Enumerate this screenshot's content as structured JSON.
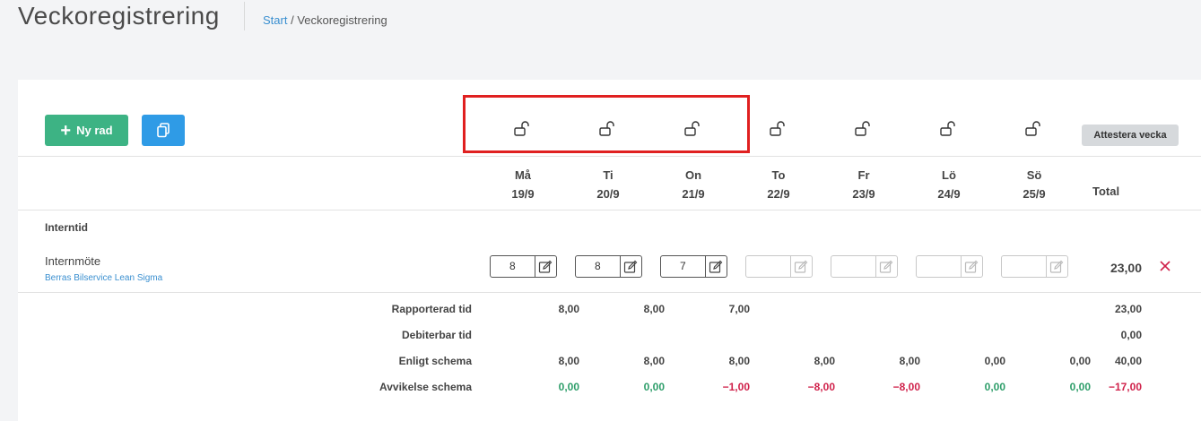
{
  "header": {
    "title": "Veckoregistrering"
  },
  "breadcrumb": {
    "start": "Start",
    "separator": " / ",
    "current": "Veckoregistrering"
  },
  "toolbar": {
    "new_row_label": "Ny rad",
    "new_row_icon": "plus-icon",
    "copy_icon": "copy-icon",
    "attest_label": "Attestera vecka"
  },
  "days": [
    {
      "name": "Må",
      "date": "19/9",
      "locked": false
    },
    {
      "name": "Ti",
      "date": "20/9",
      "locked": false
    },
    {
      "name": "On",
      "date": "21/9",
      "locked": false
    },
    {
      "name": "To",
      "date": "22/9",
      "locked": false
    },
    {
      "name": "Fr",
      "date": "23/9",
      "locked": false
    },
    {
      "name": "Lö",
      "date": "24/9",
      "locked": false
    },
    {
      "name": "Sö",
      "date": "25/9",
      "locked": false
    }
  ],
  "total_header": "Total",
  "section": "Interntid",
  "rows": [
    {
      "name": "Internmöte",
      "customer": "Berras Bilservice Lean Sigma",
      "hours": [
        "8",
        "8",
        "7",
        "",
        "",
        "",
        ""
      ],
      "total": "23,00"
    }
  ],
  "summary": [
    {
      "label": "Rapporterad tid",
      "values": [
        "8,00",
        "8,00",
        "7,00",
        "",
        "",
        "",
        ""
      ],
      "total": "23,00"
    },
    {
      "label": "Debiterbar tid",
      "values": [
        "",
        "",
        "",
        "",
        "",
        "",
        ""
      ],
      "total": "0,00"
    },
    {
      "label": "Enligt schema",
      "values": [
        "8,00",
        "8,00",
        "8,00",
        "8,00",
        "8,00",
        "0,00",
        "0,00"
      ],
      "total": "40,00"
    },
    {
      "label": "Avvikelse schema",
      "values": [
        "0,00",
        "0,00",
        "−1,00",
        "−8,00",
        "−8,00",
        "0,00",
        "0,00"
      ],
      "total": "−17,00"
    }
  ],
  "colors": {
    "accent_green": "#3db384",
    "accent_blue": "#2f9be6",
    "positive": "#2e9e6a",
    "negative": "#d0224b",
    "highlight": "#e02020"
  }
}
